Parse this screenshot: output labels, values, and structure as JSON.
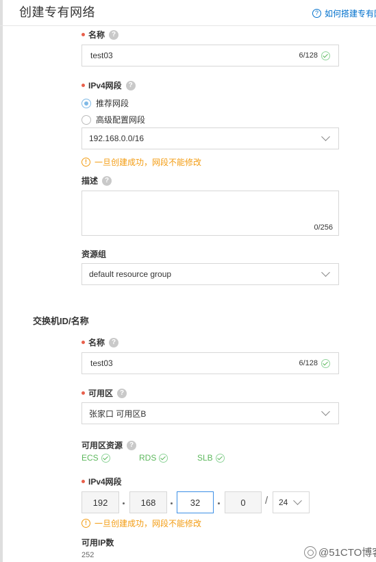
{
  "page": {
    "title": "创建专有网络",
    "help_link": "如何搭建专有网",
    "help_icon": "question-circle-icon"
  },
  "vpc": {
    "name": {
      "label": "名称",
      "value": "test03",
      "counter": "6/128"
    },
    "ipv4": {
      "label": "IPv4网段",
      "options": [
        {
          "label": "推荐网段",
          "selected": true
        },
        {
          "label": "高级配置网段",
          "selected": false
        }
      ],
      "selected_value": "192.168.0.0/16",
      "warning": "一旦创建成功，网段不能修改"
    },
    "description": {
      "label": "描述",
      "counter": "0/256"
    },
    "resource_group": {
      "label": "资源组",
      "value": "default resource group"
    }
  },
  "vswitch": {
    "section_title": "交换机ID/名称",
    "name": {
      "label": "名称",
      "value": "test03",
      "counter": "6/128"
    },
    "zone": {
      "label": "可用区",
      "value": "张家口 可用区B"
    },
    "zone_resources": {
      "label": "可用区资源",
      "items": [
        "ECS",
        "RDS",
        "SLB"
      ]
    },
    "ipv4": {
      "label": "IPv4网段",
      "octets": [
        "192",
        "168",
        "32",
        "0"
      ],
      "slash": "/",
      "mask": "24",
      "warning": "一旦创建成功，网段不能修改"
    },
    "available_ips": {
      "label": "可用IP数",
      "value": "252"
    }
  },
  "watermark": {
    "text": "@51CTO博客"
  },
  "colors": {
    "required": "#e8604c",
    "link": "#0070cc",
    "warning": "#f39c12",
    "success": "#5cb85c",
    "radio_selected": "#7fb9e6",
    "active_border": "#3a8ee6"
  }
}
